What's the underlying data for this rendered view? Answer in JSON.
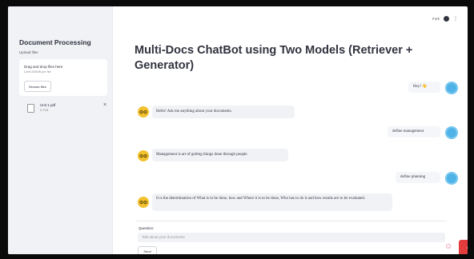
{
  "sidebar": {
    "title": "Document Processing",
    "upload_label": "Upload files",
    "dropzone_text": "Drag and drop files here",
    "dropzone_limit": "Limit 200MB per file",
    "browse_label": "Browse files",
    "file": {
      "name": "Unit 1.pdf",
      "size": "6.7KB",
      "remove": "×"
    }
  },
  "topbar": {
    "fork_label": "Fork",
    "github_icon": "github-icon",
    "menu_icon": "⋮"
  },
  "main": {
    "title": "Multi-Docs ChatBot using Two Models (Retriever + Generator)",
    "messages": [
      {
        "role": "user",
        "text": "Hey! 👋"
      },
      {
        "role": "bot",
        "text": "Hello! Ask me anything about your documents.",
        "avatar": "⊙⊙"
      },
      {
        "role": "user",
        "text": "define management"
      },
      {
        "role": "bot",
        "text": "Management is art of getting things done through people",
        "avatar": "⊙⊙"
      },
      {
        "role": "user",
        "text": "define planning"
      },
      {
        "role": "bot",
        "text": "It is the determination of What is to be done, how and Where it is to be done, Who has to do it and how results are to be evaluated.",
        "avatar": "⊙⊙"
      }
    ],
    "question_label": "Question:",
    "question_placeholder": "Talk about your documents",
    "send_label": "Send",
    "corner_icon": "♔"
  },
  "colors": {
    "user_avatar": "#4fb3e8",
    "bot_avatar": "#f2c12e",
    "badge": "#e23c3c"
  }
}
